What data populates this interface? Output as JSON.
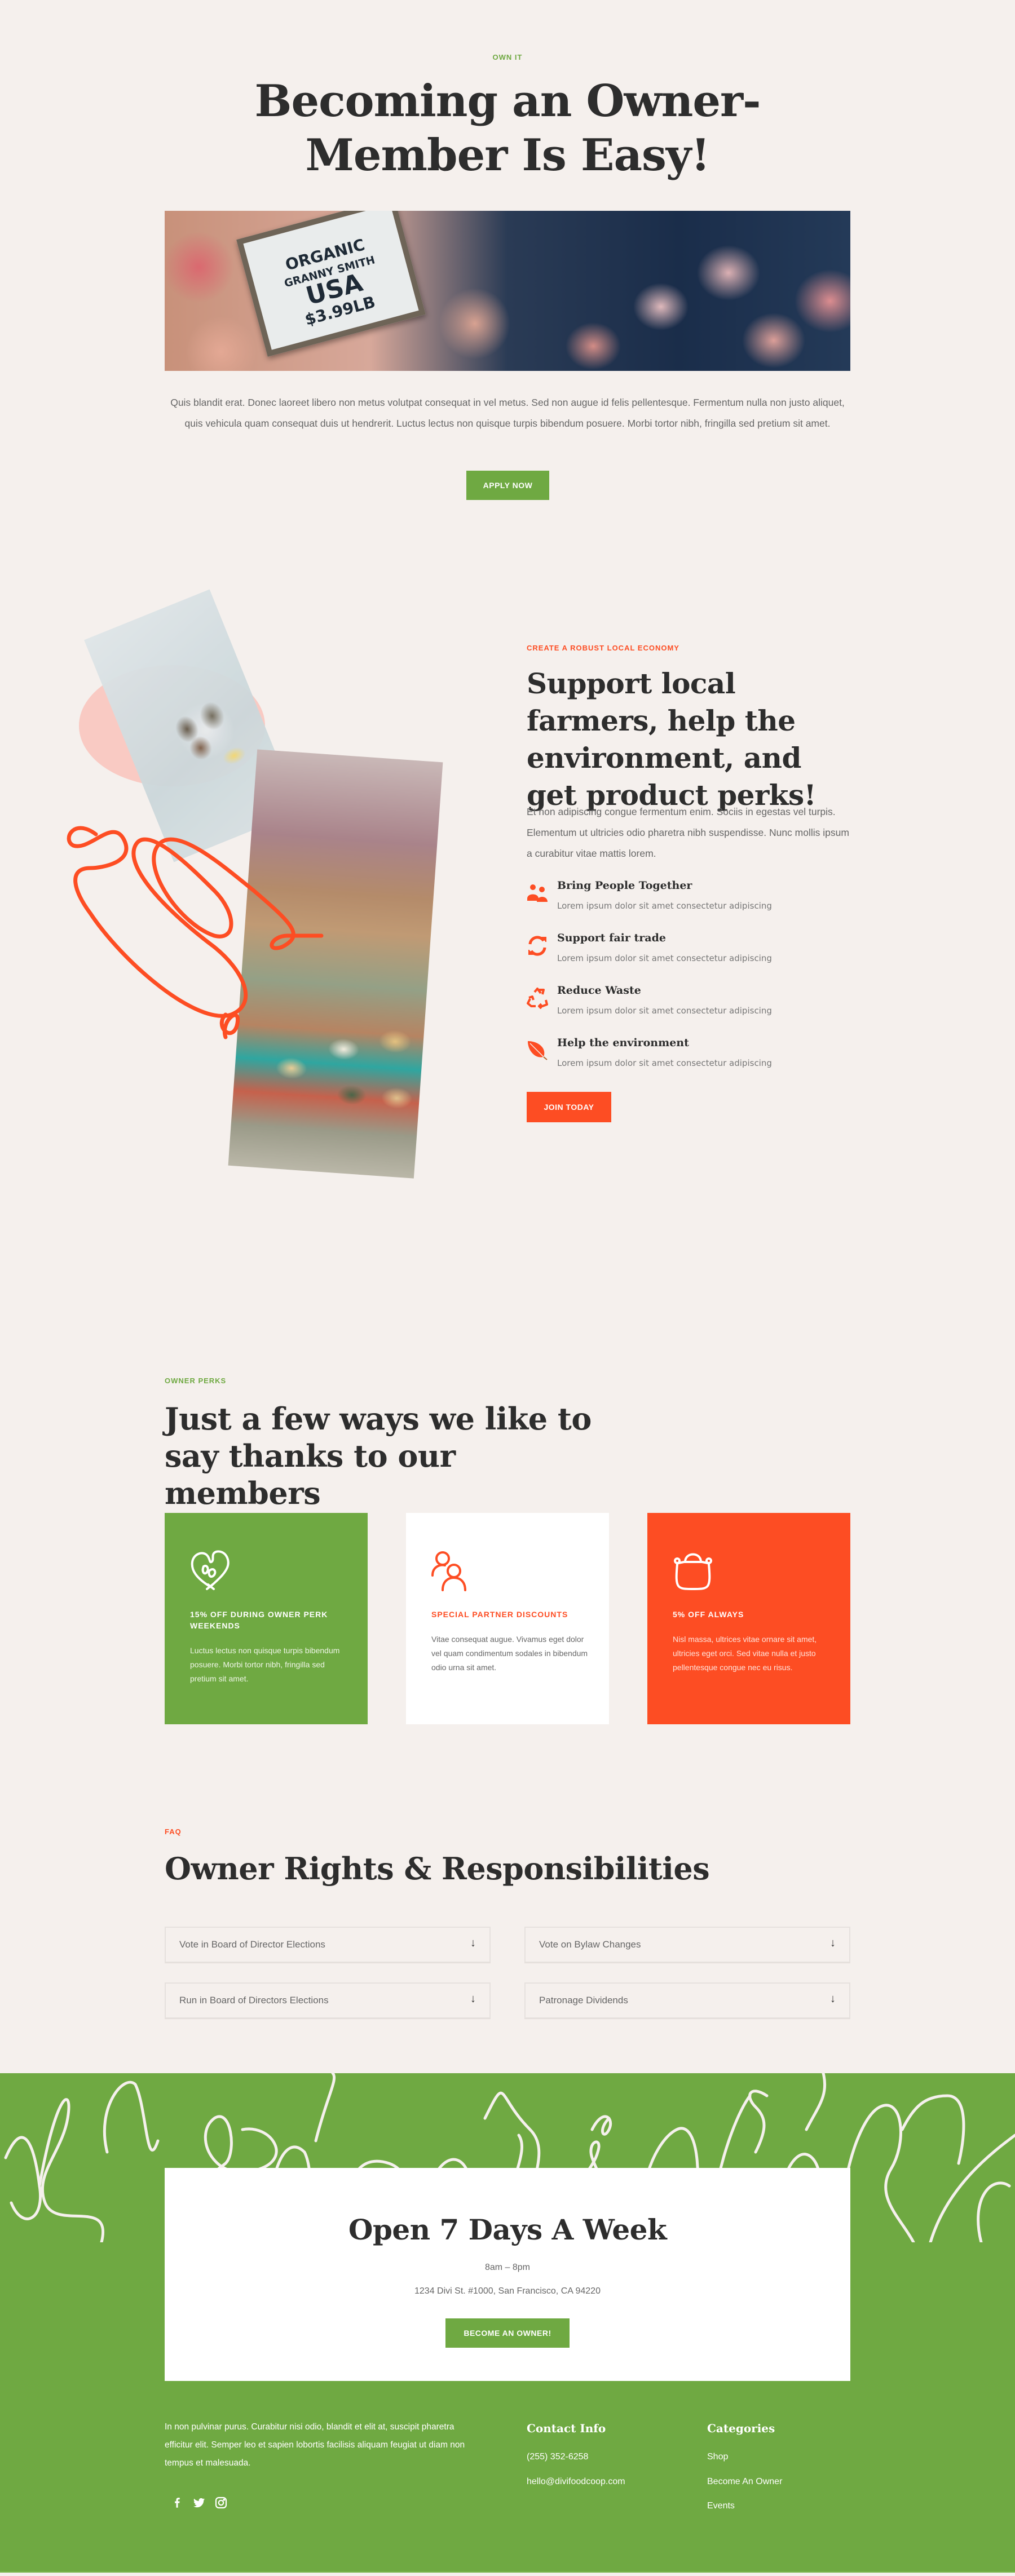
{
  "colors": {
    "background": "#f5f0ed",
    "green": "#6fa942",
    "orange": "#fd4d23",
    "text_dark": "#2d2d2d",
    "text_body": "#666666"
  },
  "own_it": {
    "eyebrow": "OWN IT",
    "title": "Becoming an Owner-Member Is Easy!",
    "hero_image": {
      "description": "Organic Granny Smith apples price sign",
      "sign_line1": "ORGANIC",
      "sign_line2": "GRANNY SMITH",
      "sign_line3": "USA",
      "sign_line4": "$3.99LB"
    },
    "text": "Quis blandit erat. Donec laoreet libero non metus volutpat consequat in vel metus. Sed non augue id felis pellentesque. Fermentum nulla non justo aliquet, quis vehicula quam consequat duis ut hendrerit. Luctus lectus non quisque turpis bibendum posuere. Morbi tortor nibh, fringilla sed pretium sit amet.",
    "button": "APPLY NOW"
  },
  "local_economy": {
    "eyebrow": "CREATE A ROBUST LOCAL ECONOMY",
    "title": "Support local farmers, help the environment, and get product perks!",
    "text": "Et non adipiscing congue fermentum enim. Sociis in egestas vel turpis. Elementum ut ultricies odio pharetra nibh suspendisse. Nunc mollis ipsum a curabitur vitae mattis lorem.",
    "images": [
      "oysters on ice with lemon",
      "farmers market produce"
    ],
    "features": [
      {
        "icon": "people-icon",
        "title": "Bring People Together",
        "desc": "Lorem ipsum dolor sit amet consectetur adipiscing"
      },
      {
        "icon": "refresh-icon",
        "title": "Support fair trade",
        "desc": "Lorem ipsum dolor sit amet consectetur adipiscing"
      },
      {
        "icon": "recycle-icon",
        "title": "Reduce Waste",
        "desc": "Lorem ipsum dolor sit amet consectetur adipiscing"
      },
      {
        "icon": "leaf-icon",
        "title": "Help the environment",
        "desc": "Lorem ipsum dolor sit amet consectetur adipiscing"
      }
    ],
    "button": "JOIN TODAY"
  },
  "perks": {
    "eyebrow": "OWNER PERKS",
    "title": "Just a few ways we like to say thanks to our members",
    "cards": [
      {
        "icon": "heart-sprout-icon",
        "title": "15% OFF DURING OWNER PERK WEEKENDS",
        "desc": "Luctus lectus non quisque turpis bibendum posuere. Morbi tortor nibh, fringilla sed pretium sit amet."
      },
      {
        "icon": "users-icon",
        "title": "SPECIAL PARTNER DISCOUNTS",
        "desc": "Vitae consequat augue. Vivamus eget dolor vel quam condimentum sodales in bibendum odio urna sit amet."
      },
      {
        "icon": "bag-icon",
        "title": "5% OFF ALWAYS",
        "desc": "Nisl massa, ultrices vitae ornare sit amet, ultricies eget orci. Sed vitae nulla et justo pellentesque congue nec eu risus."
      }
    ]
  },
  "faq": {
    "eyebrow": "FAQ",
    "title": "Owner Rights & Responsibilities",
    "items": [
      {
        "question": "Vote in Board of Director Elections",
        "toggle": "↓"
      },
      {
        "question": "Vote on Bylaw Changes",
        "toggle": "↓"
      },
      {
        "question": "Run in Board of Directors Elections",
        "toggle": "↓"
      },
      {
        "question": "Patronage Dividends",
        "toggle": "↓"
      }
    ]
  },
  "hours": {
    "title": "Open 7 Days A Week",
    "time": "8am – 8pm",
    "address": "1234 Divi St. #1000, San Francisco, CA 94220",
    "button": "BECOME AN OWNER!"
  },
  "footer": {
    "text": "In non pulvinar purus. Curabitur nisi odio, blandit et elit at, suscipit pharetra efficitur elit. Semper leo et sapien lobortis facilisis aliquam feugiat ut diam non tempus et malesuada.",
    "social": [
      "facebook-icon",
      "twitter-icon",
      "instagram-icon"
    ],
    "contact": {
      "title": "Contact Info",
      "phone": "(255) 352-6258",
      "email": "hello@divifoodcoop.com"
    },
    "categories": {
      "title": "Categories",
      "links": [
        "Shop",
        "Become An Owner",
        "Events"
      ]
    }
  }
}
